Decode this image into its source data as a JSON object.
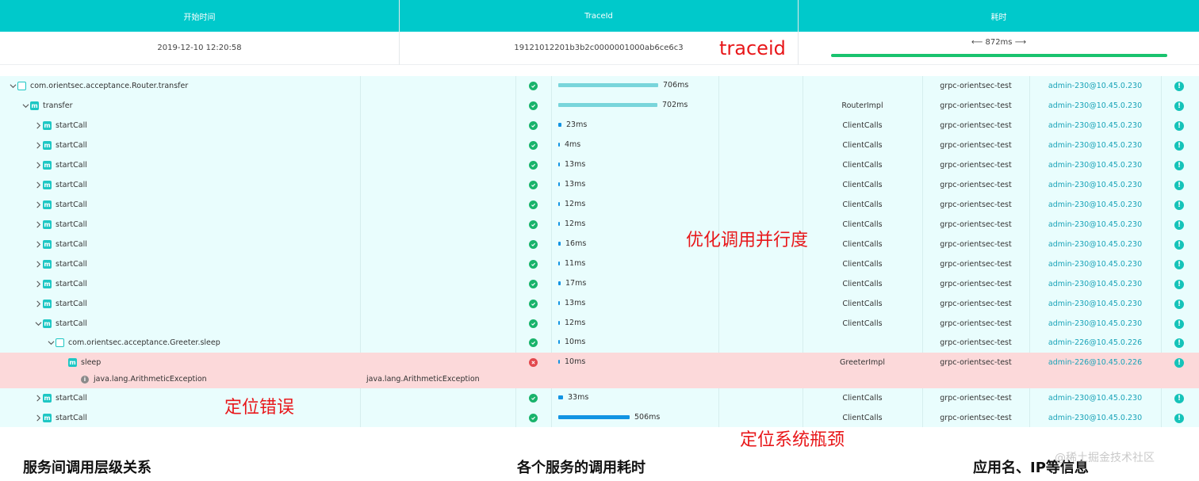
{
  "header": {
    "columns": [
      {
        "title": "开始时间",
        "value": "2019-12-10 12:20:58"
      },
      {
        "title": "TraceId",
        "value": "19121012201b3b2c0000001000ab6ce6c3"
      },
      {
        "title": "耗时",
        "value": "872ms"
      }
    ],
    "duration_fraction": 1.0,
    "duration_arrow_left": "⟵",
    "duration_arrow_right": "⟶"
  },
  "colors": {
    "accent": "#00c9cb",
    "ok": "#19b36b",
    "error": "#e2484d",
    "row_bg": "#e9fdfd",
    "error_row_bg": "#fcd9da"
  },
  "trace_total_ms": 872,
  "rows": [
    {
      "name": "com.orientsec.acceptance.Router.transfer",
      "icon": "class-icon",
      "indent": 0,
      "toggle": "expanded",
      "status": "ok",
      "ms": 706,
      "duration": "706ms",
      "component": "",
      "app": "grpc-orientsec-test",
      "ip": "admin-230@10.45.0.230"
    },
    {
      "name": "transfer",
      "icon": "method-icon",
      "indent": 1,
      "toggle": "expanded",
      "status": "ok",
      "ms": 702,
      "duration": "702ms",
      "component": "RouterImpl",
      "app": "grpc-orientsec-test",
      "ip": "admin-230@10.45.0.230"
    },
    {
      "name": "startCall",
      "icon": "method-icon",
      "indent": 2,
      "toggle": "collapsed",
      "status": "ok",
      "ms": 23,
      "duration": "23ms",
      "component": "ClientCalls",
      "app": "grpc-orientsec-test",
      "ip": "admin-230@10.45.0.230"
    },
    {
      "name": "startCall",
      "icon": "method-icon",
      "indent": 2,
      "toggle": "collapsed",
      "status": "ok",
      "ms": 4,
      "duration": "4ms",
      "component": "ClientCalls",
      "app": "grpc-orientsec-test",
      "ip": "admin-230@10.45.0.230"
    },
    {
      "name": "startCall",
      "icon": "method-icon",
      "indent": 2,
      "toggle": "collapsed",
      "status": "ok",
      "ms": 13,
      "duration": "13ms",
      "component": "ClientCalls",
      "app": "grpc-orientsec-test",
      "ip": "admin-230@10.45.0.230"
    },
    {
      "name": "startCall",
      "icon": "method-icon",
      "indent": 2,
      "toggle": "collapsed",
      "status": "ok",
      "ms": 13,
      "duration": "13ms",
      "component": "ClientCalls",
      "app": "grpc-orientsec-test",
      "ip": "admin-230@10.45.0.230"
    },
    {
      "name": "startCall",
      "icon": "method-icon",
      "indent": 2,
      "toggle": "collapsed",
      "status": "ok",
      "ms": 12,
      "duration": "12ms",
      "component": "ClientCalls",
      "app": "grpc-orientsec-test",
      "ip": "admin-230@10.45.0.230"
    },
    {
      "name": "startCall",
      "icon": "method-icon",
      "indent": 2,
      "toggle": "collapsed",
      "status": "ok",
      "ms": 12,
      "duration": "12ms",
      "component": "ClientCalls",
      "app": "grpc-orientsec-test",
      "ip": "admin-230@10.45.0.230"
    },
    {
      "name": "startCall",
      "icon": "method-icon",
      "indent": 2,
      "toggle": "collapsed",
      "status": "ok",
      "ms": 16,
      "duration": "16ms",
      "component": "ClientCalls",
      "app": "grpc-orientsec-test",
      "ip": "admin-230@10.45.0.230"
    },
    {
      "name": "startCall",
      "icon": "method-icon",
      "indent": 2,
      "toggle": "collapsed",
      "status": "ok",
      "ms": 11,
      "duration": "11ms",
      "component": "ClientCalls",
      "app": "grpc-orientsec-test",
      "ip": "admin-230@10.45.0.230"
    },
    {
      "name": "startCall",
      "icon": "method-icon",
      "indent": 2,
      "toggle": "collapsed",
      "status": "ok",
      "ms": 17,
      "duration": "17ms",
      "component": "ClientCalls",
      "app": "grpc-orientsec-test",
      "ip": "admin-230@10.45.0.230"
    },
    {
      "name": "startCall",
      "icon": "method-icon",
      "indent": 2,
      "toggle": "collapsed",
      "status": "ok",
      "ms": 13,
      "duration": "13ms",
      "component": "ClientCalls",
      "app": "grpc-orientsec-test",
      "ip": "admin-230@10.45.0.230"
    },
    {
      "name": "startCall",
      "icon": "method-icon",
      "indent": 2,
      "toggle": "expanded",
      "status": "ok",
      "ms": 12,
      "duration": "12ms",
      "component": "ClientCalls",
      "app": "grpc-orientsec-test",
      "ip": "admin-230@10.45.0.230"
    },
    {
      "name": "com.orientsec.acceptance.Greeter.sleep",
      "icon": "class-icon",
      "indent": 3,
      "toggle": "expanded",
      "status": "ok",
      "ms": 10,
      "duration": "10ms",
      "component": "",
      "app": "grpc-orientsec-test",
      "ip": "admin-226@10.45.0.226"
    },
    {
      "name": "sleep",
      "icon": "method-icon",
      "indent": 4,
      "toggle": "none",
      "status": "error",
      "ms": 10,
      "duration": "10ms",
      "component": "GreeterImpl",
      "app": "grpc-orientsec-test",
      "ip": "admin-226@10.45.0.226",
      "error": true
    },
    {
      "name": "java.lang.ArithmeticException",
      "icon": "info-icon",
      "indent": 5,
      "toggle": "none",
      "status": "none",
      "ms": null,
      "duration": "",
      "component": "",
      "app": "",
      "ip": "",
      "error": true,
      "detail": "java.lang.ArithmeticException",
      "exception": true
    },
    {
      "name": "startCall",
      "icon": "method-icon",
      "indent": 2,
      "toggle": "collapsed",
      "status": "ok",
      "ms": 33,
      "duration": "33ms",
      "component": "ClientCalls",
      "app": "grpc-orientsec-test",
      "ip": "admin-230@10.45.0.230"
    },
    {
      "name": "startCall",
      "icon": "method-icon",
      "indent": 2,
      "toggle": "collapsed",
      "status": "ok",
      "ms": 506,
      "duration": "506ms",
      "component": "ClientCalls",
      "app": "grpc-orientsec-test",
      "ip": "admin-230@10.45.0.230"
    }
  ],
  "annotations": {
    "traceid": "traceid",
    "optimize": "优化调用并行度",
    "locate_error": "定位错误",
    "locate_bottleneck": "定位系统瓶颈"
  },
  "captions": {
    "hierarchy": "服务间调用层级关系",
    "timing": "各个服务的调用耗时",
    "appinfo": "应用名、IP等信息"
  },
  "watermark": "@稀土掘金技术社区"
}
